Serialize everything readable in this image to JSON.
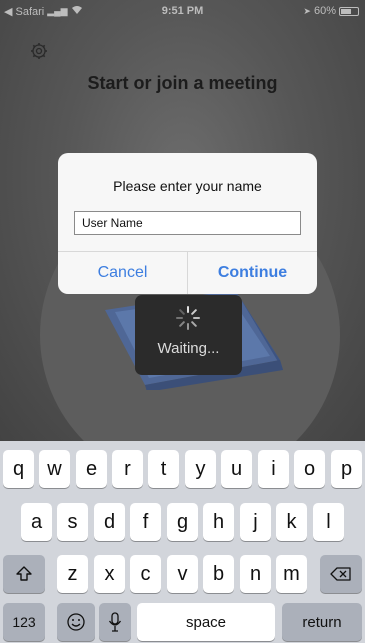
{
  "status_bar": {
    "back_app": "◀ Safari",
    "time": "9:51 PM",
    "battery": "60%"
  },
  "app": {
    "headline": "Start or join a meeting",
    "waiting": "Waiting..."
  },
  "dialog": {
    "title": "Please enter your name",
    "name_value": "User Name",
    "cancel": "Cancel",
    "continue": "Continue"
  },
  "keyboard": {
    "row1": [
      "q",
      "w",
      "e",
      "r",
      "t",
      "y",
      "u",
      "i",
      "o",
      "p"
    ],
    "row2": [
      "a",
      "s",
      "d",
      "f",
      "g",
      "h",
      "j",
      "k",
      "l"
    ],
    "row3": [
      "z",
      "x",
      "c",
      "v",
      "b",
      "n",
      "m"
    ],
    "numbers": "123",
    "space": "space",
    "return": "return",
    "shift_icon": "shift-icon",
    "delete_icon": "delete-icon",
    "emoji_icon": "emoji-icon",
    "mic_icon": "microphone-icon"
  },
  "colors": {
    "accent": "#3d7ee0",
    "keyboard_bg": "#d2d5db"
  }
}
